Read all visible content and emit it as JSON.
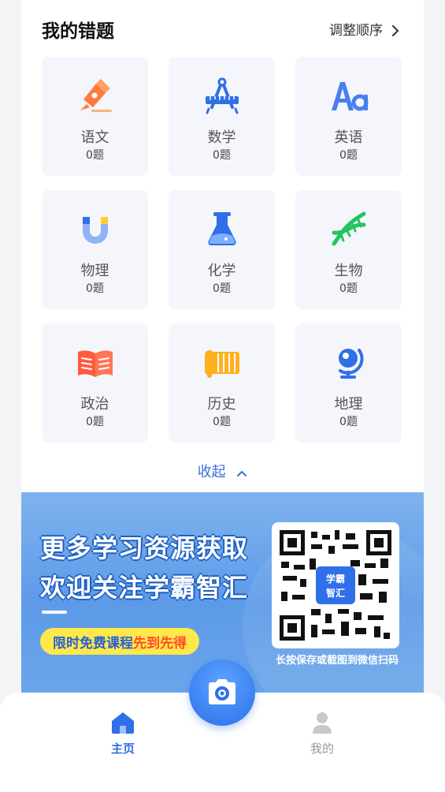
{
  "section": {
    "title": "我的错题",
    "reorder_label": "调整顺序",
    "collapse_label": "收起"
  },
  "subjects": [
    {
      "name": "语文",
      "count": "0题",
      "icon": "pen-nib-icon"
    },
    {
      "name": "数学",
      "count": "0题",
      "icon": "compass-ruler-icon"
    },
    {
      "name": "英语",
      "count": "0题",
      "icon": "letters-aa-icon"
    },
    {
      "name": "物理",
      "count": "0题",
      "icon": "magnet-icon"
    },
    {
      "name": "化学",
      "count": "0题",
      "icon": "flask-icon"
    },
    {
      "name": "生物",
      "count": "0题",
      "icon": "dna-icon"
    },
    {
      "name": "政治",
      "count": "0题",
      "icon": "open-book-icon"
    },
    {
      "name": "历史",
      "count": "0题",
      "icon": "scroll-icon"
    },
    {
      "name": "地理",
      "count": "0题",
      "icon": "globe-icon"
    }
  ],
  "banner": {
    "line1": "更多学习资源获取",
    "line2": "欢迎关注学霸智汇",
    "promo_a": "限时免费课程",
    "promo_b": "先到先得",
    "qr_badge": "学霸智汇",
    "qr_hint": "长按保存或截图到微信扫码"
  },
  "tabbar": {
    "home_label": "主页",
    "mine_label": "我的"
  },
  "colors": {
    "accent": "#2f6fe8",
    "tile_bg": "#f4f6fb",
    "promo_yellow": "#ffe94a",
    "promo_red": "#ff4a2d"
  }
}
